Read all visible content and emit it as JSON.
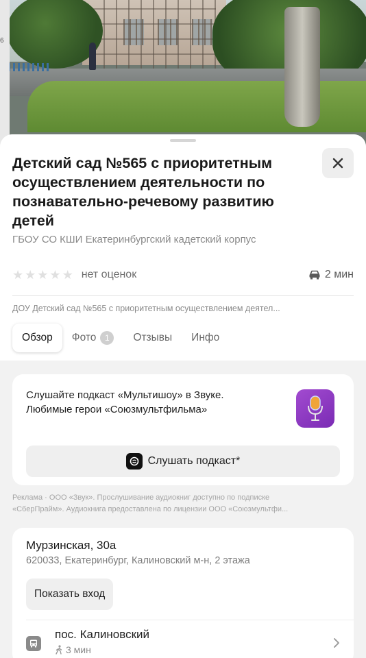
{
  "photo": {
    "edge_label": "6"
  },
  "place": {
    "title": "Детский сад №565 с приоритетным осуществлением деятельности по познавательно-речевому развитию детей",
    "organization": "ГБОУ СО КШИ Екатеринбургский кадетский корпус",
    "rating_text": "нет оценок",
    "rating_value": 0,
    "eta": "2 мин",
    "description": "ДОУ Детский сад №565 с приоритетным осуществлением деятел..."
  },
  "tabs": [
    {
      "label": "Обзор"
    },
    {
      "label": "Фото",
      "count": "1"
    },
    {
      "label": "Отзывы"
    },
    {
      "label": "Инфо"
    }
  ],
  "ad": {
    "text_line1": "Слушайте подкаст «Мультишоу» в Звуке.",
    "text_line2": "Любимые герои «Союзмультфильма»",
    "button_label": "Слушать подкаст*",
    "disclaimer_line1": "Реклама · ООО «Звук». Прослушивание аудиокниг доступно по подписке",
    "disclaimer_line2": "«СберПрайм». Аудиокнига предоставлена по лицензии ООО «Союзмультфи..."
  },
  "address": {
    "street": "Мурзинская, 30а",
    "details": "620033, Екатеринбург, Калиновский м-н, 2 этажа",
    "entrance_button": "Показать вход",
    "stop_name": "пос. Калиновский",
    "stop_walk": "3 мин"
  },
  "colors": {
    "accent_purple": "#8e3cc4",
    "sheet_bg": "#f2f2f2",
    "card_bg": "#ffffff"
  }
}
